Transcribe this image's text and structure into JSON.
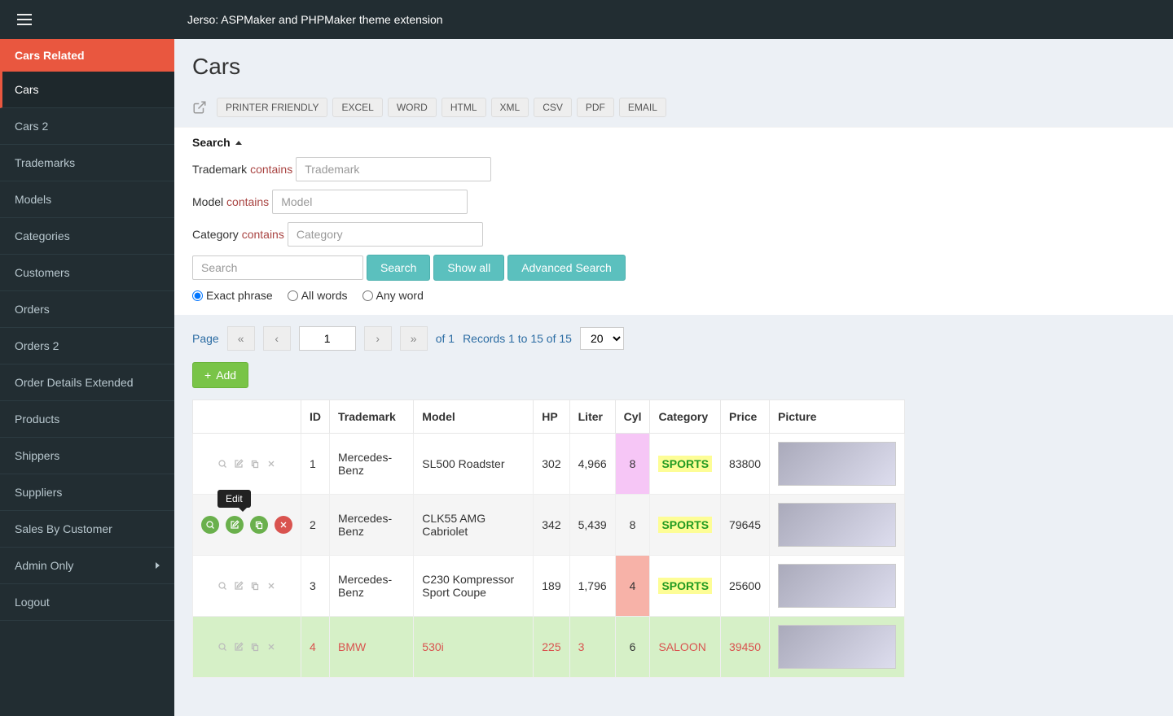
{
  "topbar": {
    "title": "Jerso: ASPMaker and PHPMaker theme extension"
  },
  "sidebar": {
    "header": "Cars Related",
    "items": [
      {
        "label": "Cars",
        "active": true
      },
      {
        "label": "Cars 2"
      },
      {
        "label": "Trademarks"
      },
      {
        "label": "Models"
      },
      {
        "label": "Categories"
      },
      {
        "label": "Customers"
      },
      {
        "label": "Orders"
      },
      {
        "label": "Orders 2"
      },
      {
        "label": "Order Details Extended"
      },
      {
        "label": "Products"
      },
      {
        "label": "Shippers"
      },
      {
        "label": "Suppliers"
      },
      {
        "label": "Sales By Customer"
      },
      {
        "label": "Admin Only",
        "chevron": true
      },
      {
        "label": "Logout"
      }
    ]
  },
  "page": {
    "title": "Cars"
  },
  "exportButtons": [
    "PRINTER FRIENDLY",
    "EXCEL",
    "WORD",
    "HTML",
    "XML",
    "CSV",
    "PDF",
    "EMAIL"
  ],
  "search": {
    "heading": "Search",
    "fields": [
      {
        "label": "Trademark",
        "op": "contains",
        "placeholder": "Trademark"
      },
      {
        "label": "Model",
        "op": "contains",
        "placeholder": "Model"
      },
      {
        "label": "Category",
        "op": "contains",
        "placeholder": "Category"
      }
    ],
    "quickPlaceholder": "Search",
    "searchBtn": "Search",
    "showAllBtn": "Show all",
    "advancedBtn": "Advanced Search",
    "radios": [
      "Exact phrase",
      "All words",
      "Any word"
    ],
    "selectedRadio": 0
  },
  "pager": {
    "label": "Page",
    "current": "1",
    "of": "of 1",
    "records": "Records 1 to 15 of 15",
    "pageSize": "20"
  },
  "addBtn": "Add",
  "tooltip": "Edit",
  "table": {
    "headers": [
      "ID",
      "Trademark",
      "Model",
      "HP",
      "Liter",
      "Cyl",
      "Category",
      "Price",
      "Picture"
    ],
    "rows": [
      {
        "id": "1",
        "trademark": "Mercedes-Benz",
        "model": "SL500 Roadster",
        "hp": "302",
        "liter": "4,966",
        "cyl": "8",
        "cylClass": "cyl-pink",
        "category": "SPORTS",
        "catStyle": "badge",
        "price": "83800",
        "rowClass": "",
        "actions": "idle"
      },
      {
        "id": "2",
        "trademark": "Mercedes-Benz",
        "model": "CLK55 AMG Cabriolet",
        "hp": "342",
        "liter": "5,439",
        "cyl": "8",
        "cylClass": "cyl-pink",
        "category": "SPORTS",
        "catStyle": "badge",
        "price": "79645",
        "rowClass": "row-gray",
        "actions": "active"
      },
      {
        "id": "3",
        "trademark": "Mercedes-Benz",
        "model": "C230 Kompressor Sport Coupe",
        "hp": "189",
        "liter": "1,796",
        "cyl": "4",
        "cylClass": "cyl-red",
        "category": "SPORTS",
        "catStyle": "badge",
        "price": "25600",
        "rowClass": "",
        "actions": "idle"
      },
      {
        "id": "4",
        "trademark": "BMW",
        "model": "530i",
        "hp": "225",
        "liter": "3",
        "cyl": "6",
        "cylClass": "cyl-orange",
        "category": "SALOON",
        "catStyle": "saloon",
        "price": "39450",
        "rowClass": "row-green",
        "actions": "idle"
      }
    ]
  }
}
